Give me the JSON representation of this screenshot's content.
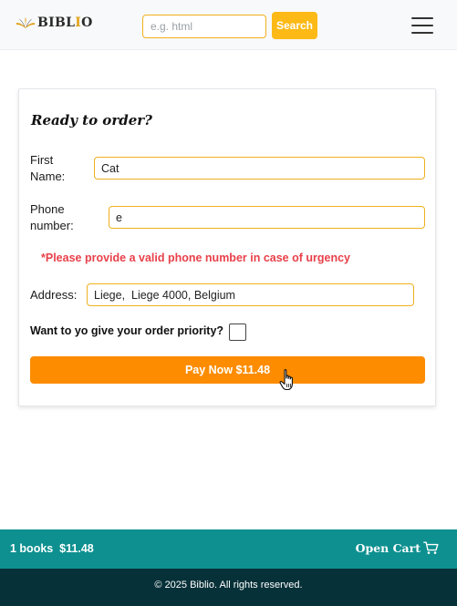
{
  "header": {
    "logo_text_before": "BIBL",
    "logo_text_accent": "I",
    "logo_text_after": "O",
    "search": {
      "value": "",
      "placeholder": "e.g. html"
    },
    "search_button": "Search",
    "menu_icon": "hamburger-icon"
  },
  "form": {
    "title": "Ready to order?",
    "first_name": {
      "label_line1": "First",
      "label_line2": "Name:",
      "value": "Cat"
    },
    "phone": {
      "label_line1": "Phone",
      "label_line2": "number:",
      "value": "e"
    },
    "phone_warning": "*Please provide a valid phone number in case of urgency",
    "address": {
      "label": "Address:",
      "value": "Liege,  Liege 4000, Belgium"
    },
    "priority": {
      "label": "Want to yo give your order priority?",
      "checked": false
    },
    "pay_button": "Pay Now $11.48"
  },
  "cart_bar": {
    "summary": "1 books  $11.48",
    "open_cart": "Open Cart",
    "cart_icon": "shopping-cart-icon"
  },
  "footer": {
    "copyright": "© 2025 Biblio. All rights reserved."
  },
  "colors": {
    "accent": "#fdb915",
    "pay_button": "#fd8c00",
    "warning": "#e8404a",
    "cart_bar": "#0e9090",
    "footer": "#073138"
  }
}
